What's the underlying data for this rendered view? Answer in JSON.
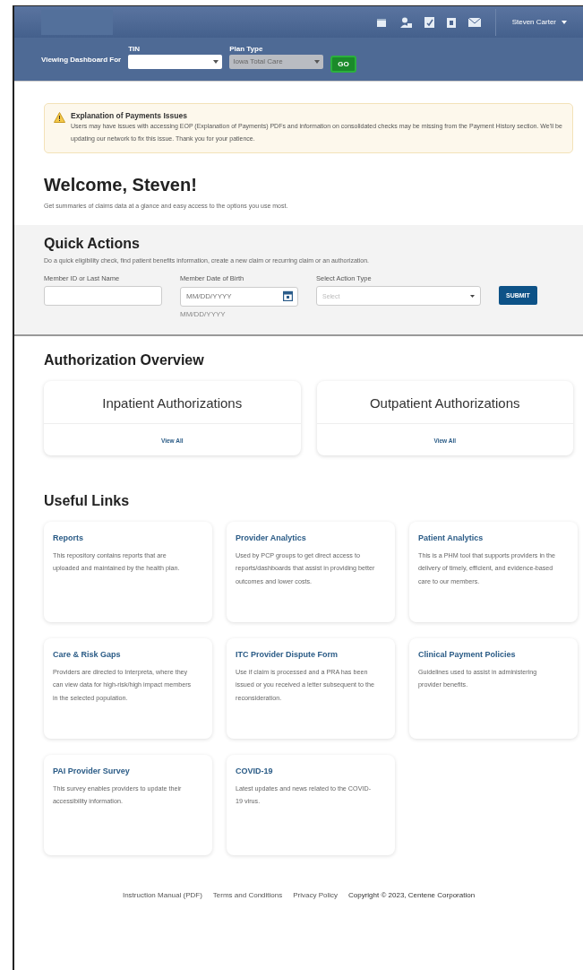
{
  "header": {
    "user_name": "Steven Carter"
  },
  "filter_bar": {
    "label": "Viewing Dashboard For",
    "fields": [
      {
        "label": "TIN",
        "disabled": false
      },
      {
        "label": "Plan Type",
        "value": "Iowa Total Care",
        "disabled": true
      }
    ],
    "go": "GO"
  },
  "notice": {
    "title": "Explanation of Payments Issues",
    "text": "Users may have issues with accessing EOP (Explanation of Payments) PDFs and information on consolidated checks may be missing from the Payment History section. We'll be updating our network to fix this issue.  Thank you for your patience."
  },
  "welcome": {
    "title": "Welcome, Steven!",
    "subtitle": "Get summaries of claims data at a glance and easy access to the options you use most."
  },
  "quick_actions": {
    "title": "Quick Actions",
    "description": "Do a quick eligibility check, find patient benefits information, create a new claim or recurring claim or an authorization.",
    "fields": [
      {
        "kind": "text",
        "label": "Member ID or Last Name"
      },
      {
        "kind": "date",
        "label": "Member Date of Birth",
        "placeholder": "MM/DD/YYYY",
        "hint": "MM/DD/YYYY"
      },
      {
        "kind": "select",
        "label": "Select Action Type",
        "placeholder": "Select"
      }
    ],
    "submit": "SUBMIT"
  },
  "authorization_overview": {
    "title": "Authorization Overview",
    "cards": [
      {
        "title": "Inpatient Authorizations",
        "link": "View All"
      },
      {
        "title": "Outpatient Authorizations",
        "link": "View All"
      }
    ]
  },
  "useful_links": {
    "title": "Useful Links",
    "items": [
      {
        "title": "Reports",
        "description": "This repository contains reports that are uploaded and maintained by the health plan."
      },
      {
        "title": "Provider Analytics",
        "description": "Used by PCP groups to get direct access to reports/dashboards that assist in providing better outcomes and lower costs."
      },
      {
        "title": "Patient Analytics",
        "description": "This is a PHM tool that supports providers in the delivery of timely, efficient, and evidence-based care to our members."
      },
      {
        "title": "Care & Risk Gaps",
        "description": "Providers are directed to Interpreta, where they can view data for high-risk/high impact members in the selected population."
      },
      {
        "title": "ITC Provider Dispute Form",
        "description": "Use if claim is processed and a PRA has been issued or you received a letter subsequent to the reconsideration."
      },
      {
        "title": "Clinical Payment Policies",
        "description": "Guidelines used to assist in administering provider benefits."
      },
      {
        "title": "PAI Provider Survey",
        "description": "This survey enables providers to update their accessibility information."
      },
      {
        "title": "COVID-19",
        "description": "Latest updates and news related to the COVID-19 virus."
      }
    ]
  },
  "footer": {
    "links": [
      "Instruction Manual (PDF)",
      "Terms and Conditions",
      "Privacy Policy"
    ],
    "copyright": "Copyright © 2023, Centene Corporation"
  }
}
